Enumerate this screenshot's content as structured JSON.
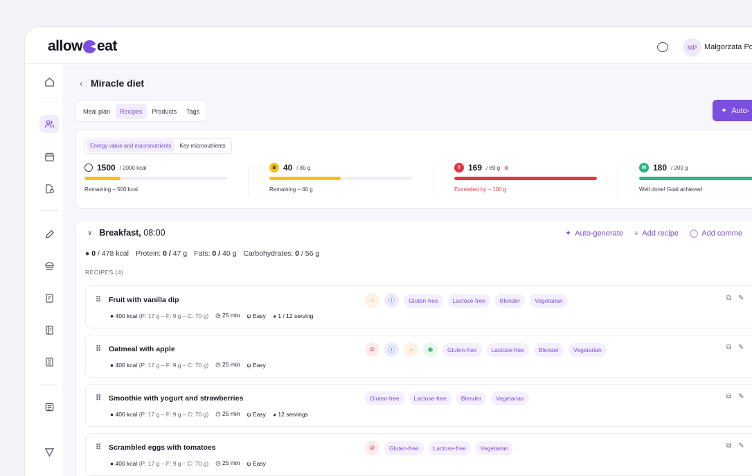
{
  "app": {
    "logo_text_1": "allow",
    "logo_text_2": "eat"
  },
  "header": {
    "avatar_initials": "MP",
    "user_name": "Małgorzata Po"
  },
  "page": {
    "back_icon": "‹",
    "title": "Miracle diet"
  },
  "tabs": [
    {
      "label": "Meal plan",
      "active": false
    },
    {
      "label": "Recipes",
      "active": true
    },
    {
      "label": "Products",
      "active": false
    },
    {
      "label": "Tags",
      "active": false
    }
  ],
  "auto_button": {
    "label": "Auto-"
  },
  "summary": {
    "subtabs": [
      {
        "label": "Energy value and macronutrients",
        "active": true
      },
      {
        "label": "Key micronutrients",
        "active": false
      }
    ],
    "metrics": [
      {
        "icon": "",
        "value": "1500",
        "total": "/ 2000 kcal",
        "note": "Remaining – 500 kcal",
        "fill": 0.25,
        "color": "#f2c21b"
      },
      {
        "icon": "B",
        "value": "40",
        "total": "/ 80 g",
        "note": "Remaining – 40 g",
        "fill": 0.5,
        "color": "#f2c21b"
      },
      {
        "icon": "T",
        "value": "169",
        "total": "/ 69 g",
        "note": "Exceeded by – 100 g",
        "fill": 1.0,
        "color": "#e0364a"
      },
      {
        "icon": "W",
        "value": "180",
        "total": "/ 200 g",
        "note": "Well done! Goal achieved",
        "fill": 1.0,
        "color": "#2fb57d"
      }
    ]
  },
  "meal": {
    "name": "Breakfast,",
    "time": "08:00",
    "actions": {
      "auto_generate": "Auto-generate",
      "add_recipe": "Add recipe",
      "add_comment": "Add comme"
    },
    "macros": {
      "kcal_value": "0",
      "kcal_total": "/ 478 kcal",
      "protein_label": "Protein:",
      "protein_value": "0 /",
      "protein_total": "47 g",
      "fats_label": "Fats:",
      "fats_value": "0 /",
      "fats_total": "40 g",
      "carbs_label": "Carbohydrates:",
      "carbs_value": "0",
      "carbs_total": "/ 56 g"
    },
    "recipes_label": "RECIPES (4)",
    "recipes": [
      {
        "name": "Fruit with vanilla dip",
        "kcal": "400 kcal",
        "macros": "(P: 17 g – F: 9 g – C: 70 g)",
        "time": "25 min",
        "difficulty": "Easy",
        "servings": "1 / 12 serving",
        "icons": [
          "orange",
          "blue"
        ],
        "tags": [
          "Gluten-free",
          "Lactose-free",
          "Blender",
          "Vegetarian"
        ]
      },
      {
        "name": "Oatmeal with apple",
        "kcal": "400 kcal",
        "macros": "(P: 17 g – F: 9 g – C: 70 g)",
        "time": "25 min",
        "difficulty": "Easy",
        "servings": "",
        "icons": [
          "red",
          "blue",
          "orange",
          "green"
        ],
        "tags": [
          "Gluten-free",
          "Lactose-free",
          "Blender",
          "Vegetarian"
        ]
      },
      {
        "name": "Smoothie with yogurt and strawberries",
        "kcal": "400 kcal",
        "macros": "(P: 17 g – F: 9 g – C: 70 g)",
        "time": "25 min",
        "difficulty": "Easy",
        "servings": "12 servings",
        "icons": [],
        "tags": [
          "Gluten-free",
          "Lactose-free",
          "Blender",
          "Vegetarian"
        ]
      },
      {
        "name": "Scrambled eggs with tomatoes",
        "kcal": "400 kcal",
        "macros": "(P: 17 g – F: 9 g – C: 70 g)",
        "time": "25 min",
        "difficulty": "Easy",
        "servings": "",
        "icons": [
          "red"
        ],
        "tags": [
          "Gluten-free",
          "Lactose-free",
          "Vegetarian"
        ]
      }
    ]
  }
}
